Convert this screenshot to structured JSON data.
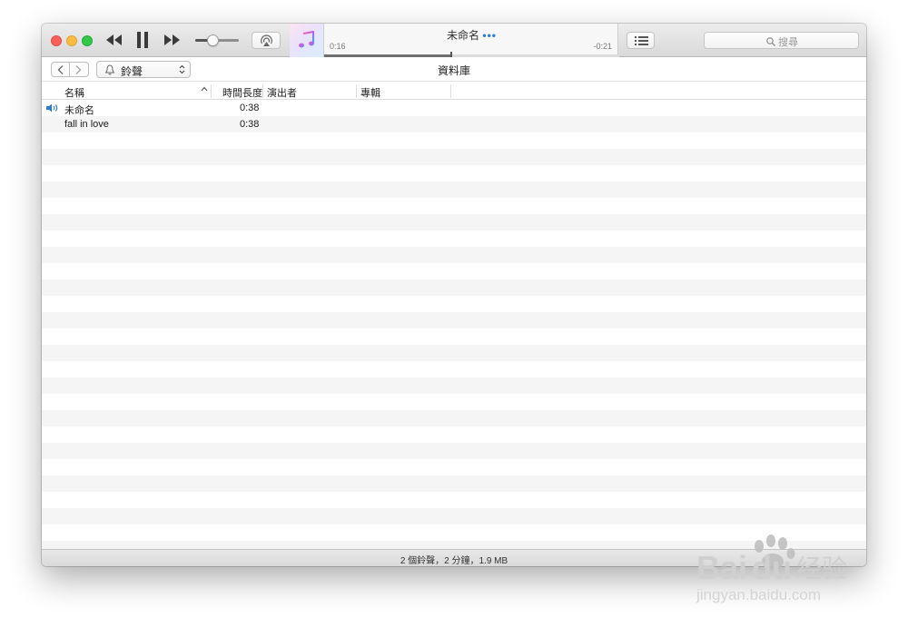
{
  "player": {
    "now_playing_title": "未命名",
    "more_dots": "•••",
    "elapsed": "0:16",
    "remaining": "-0:21",
    "progress": 0.43,
    "volume": 0.4
  },
  "search": {
    "placeholder": "搜尋"
  },
  "nav": {
    "media_kind": "鈴聲",
    "title": "資料庫"
  },
  "columns": {
    "name": "名稱",
    "time": "時間長度",
    "artist": "演出者",
    "album": "專輯"
  },
  "tracks": [
    {
      "name": "未命名",
      "time": "0:38",
      "artist": "",
      "album": "",
      "playing": true
    },
    {
      "name": "fall in love",
      "time": "0:38",
      "artist": "",
      "album": "",
      "playing": false
    }
  ],
  "status": {
    "summary": "2 個鈴聲，2 分鐘，1.9 MB"
  },
  "colors": {
    "accent": "#2a7ae0",
    "row_stripe": "#f5f5f5",
    "close": "#fc605c",
    "minimize": "#fdbc40",
    "zoom": "#34c84a"
  },
  "watermark": {
    "text": "Baidu经验",
    "url_text": "jingyan.baidu.com"
  }
}
